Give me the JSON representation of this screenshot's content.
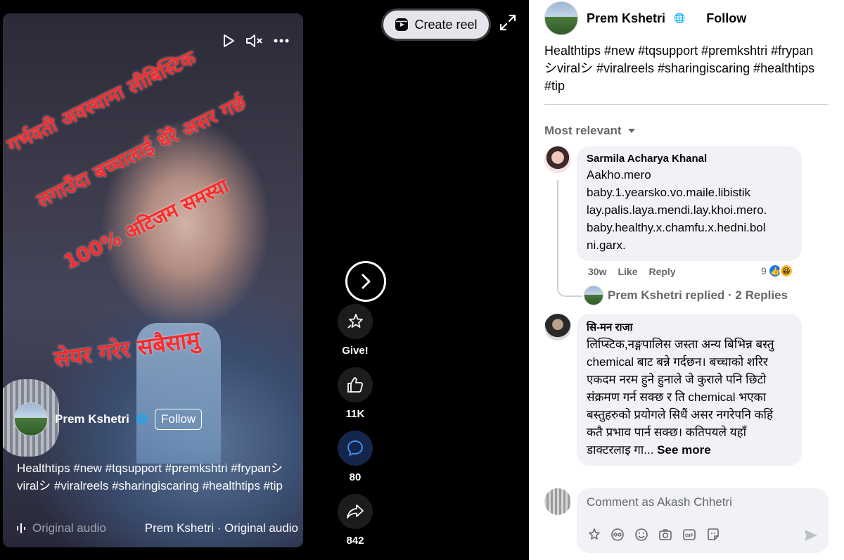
{
  "video": {
    "overlay_lines": [
      "गर्भवती अवस्थामा लीबिस्टिक",
      "लगाउँदा बच्चालाई धेरै असर गर्छ",
      "100% अटिजम समस्या",
      "सेयर गरेर सबैसामु"
    ],
    "author": "Prem Kshetri",
    "follow_label": "Follow",
    "caption": "Healthtips #new #tqsupport #premkshtri #frypanシviralシ #viralreels #sharingiscaring #healthtips #tip",
    "audio_left": "Original audio",
    "audio_right": "Prem Kshetri · Original audio"
  },
  "toolbar": {
    "create_reel_label": "Create reel"
  },
  "actions": {
    "give_label": "Give!",
    "like_count": "11K",
    "comment_count": "80",
    "share_count": "842"
  },
  "panel": {
    "author": "Prem Kshetri",
    "follow_label": "Follow",
    "caption": "Healthtips #new #tqsupport #premkshtri #frypanシviralシ #viralreels #sharingiscaring #healthtips #tip",
    "sort_label": "Most relevant",
    "comments": [
      {
        "name": "Sarmila Acharya Khanal",
        "text": "Aakho.mero baby.1.yearsko.vo.maile.libistik lay.palis.laya.mendi.lay.khoi.mero. baby.healthy.x.chamfu.x.hedni.bol ni.garx.",
        "time": "30w",
        "like_label": "Like",
        "reply_label": "Reply",
        "reaction_count": "9"
      },
      {
        "name": "सि-मन राजा",
        "text": "लिप्स्टिक,नङ्गपालिस जस्ता अन्य बिभिन्न बस्तु chemical बाट बन्ने गर्दछन। बच्चाको शरिर एकदम नरम हुने हुनाले जे कुराले पनि छिटो संक्रमण गर्न सक्छ र ति chemical भएका बस्तुहरुको प्रयोगले सिधैं असर नगरेपनि कहिं कतै प्रभाव पार्न सक्छ। कतिपयले यहाँ डाक्टरलाइ गा...",
        "see_more": "See more"
      }
    ],
    "replies_text": "Prem Kshetri replied · 2 Replies",
    "composer_placeholder": "Comment as Akash Chhetri"
  },
  "colors": {
    "accent": "#1877f2",
    "overlay_text": "#ff2a2a",
    "panel_bg": "#ffffff",
    "bubble_bg": "#f0f2f5"
  },
  "icons": {
    "video_controls": [
      "play-icon",
      "mute-icon",
      "more-icon"
    ],
    "rail": [
      "next-arrow-icon",
      "give-star-icon",
      "like-thumb-icon",
      "comment-icon",
      "share-icon"
    ],
    "composer_tools": [
      "sticker-icon",
      "avatar-sticker-icon",
      "emoji-icon",
      "camera-icon",
      "gif-icon",
      "sticker-face-icon",
      "send-icon"
    ]
  }
}
